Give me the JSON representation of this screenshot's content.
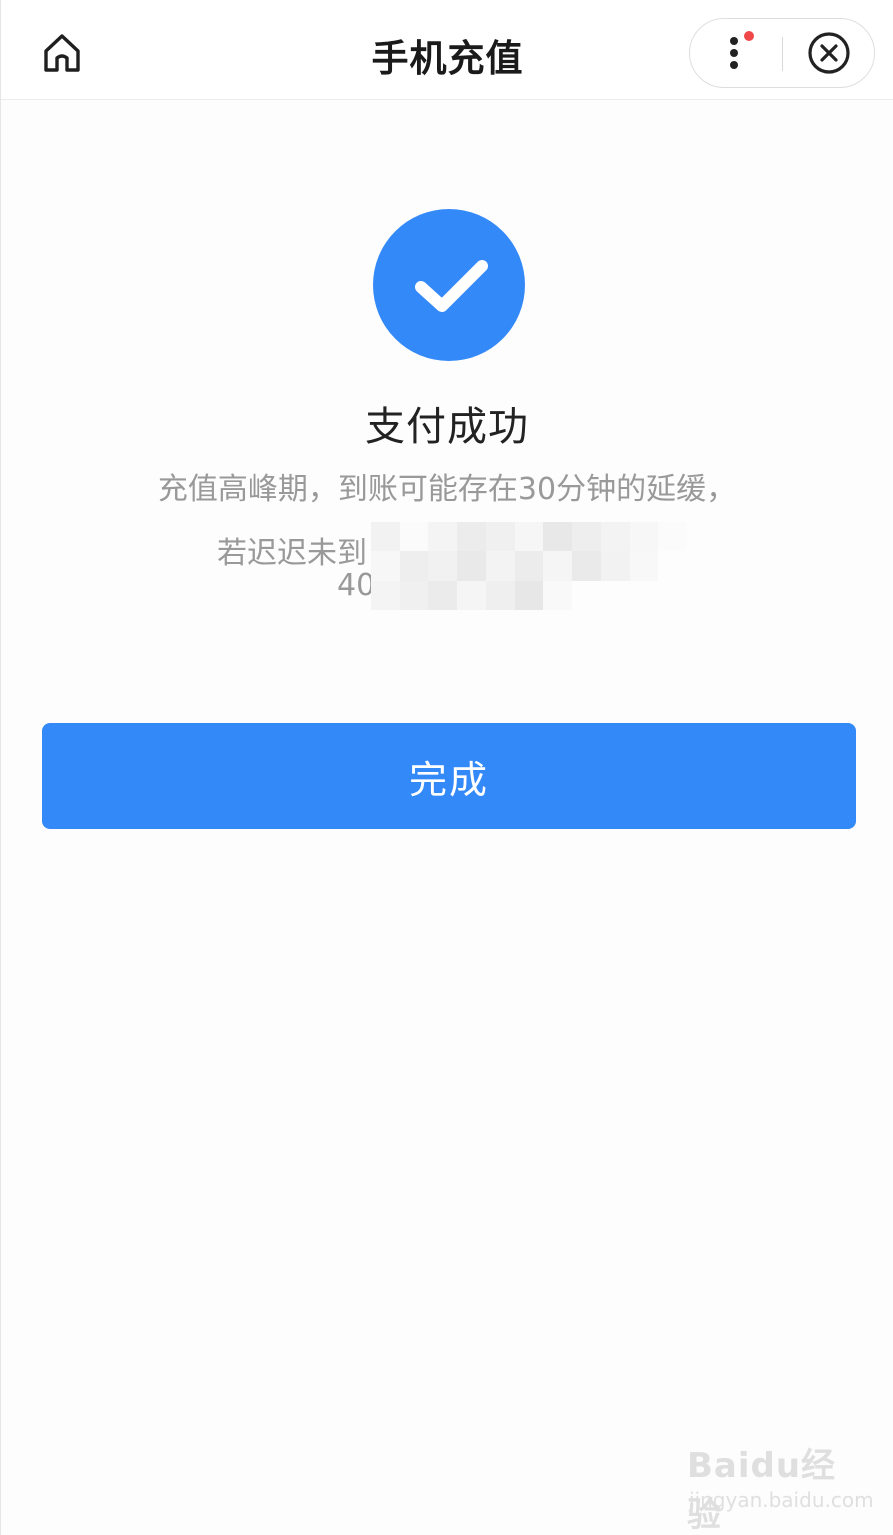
{
  "header": {
    "title": "手机充值",
    "home_icon": "home-icon",
    "menu_icon": "more-vertical-icon",
    "close_icon": "close-circle-icon",
    "notification_dot_color": "#f04848"
  },
  "result": {
    "status_icon": "check-circle-icon",
    "status_color": "#3489f9",
    "title": "支付成功",
    "notice_line1": "充值高峰期，到账可能存在30分钟的延缓，",
    "notice_line2_visible": "若迟迟未到",
    "notice_line3_visible": "40"
  },
  "actions": {
    "done_label": "完成",
    "done_color": "#3489f9"
  },
  "watermark": {
    "logo": "Baidu经验",
    "url": "jingyan.baidu.com"
  }
}
